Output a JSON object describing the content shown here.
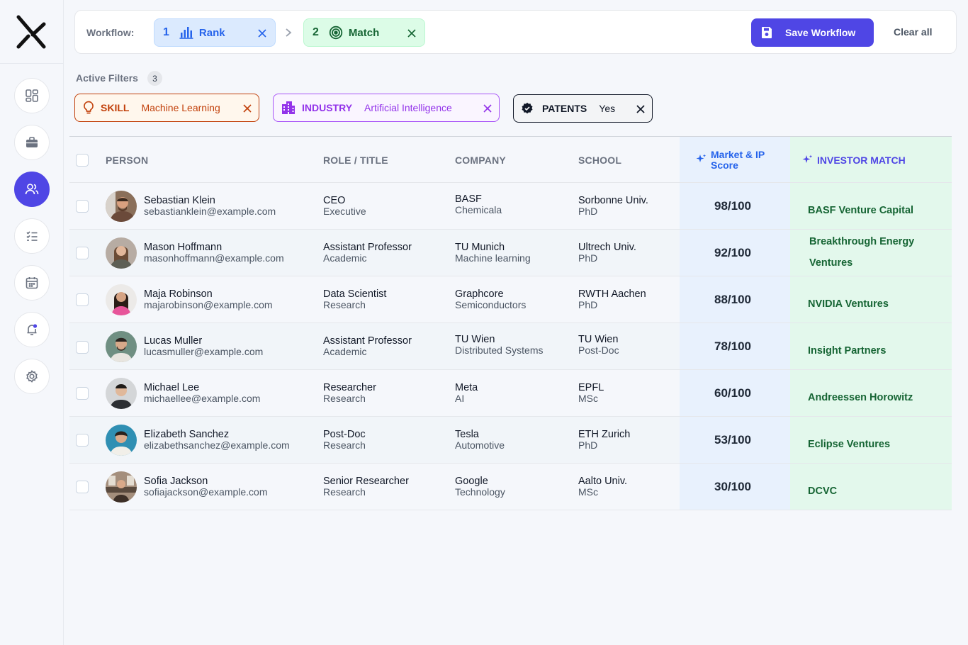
{
  "workflow": {
    "label": "Workflow:",
    "steps": [
      {
        "num": "1",
        "label": "Rank",
        "icon": "bar-chart-icon"
      },
      {
        "num": "2",
        "label": "Match",
        "icon": "target-icon"
      }
    ],
    "save_label": "Save Workflow",
    "clear_label": "Clear all"
  },
  "filters": {
    "label": "Active Filters",
    "count": "3",
    "chips": [
      {
        "key": "SKILL",
        "value": "Machine Learning",
        "icon": "lightbulb-icon"
      },
      {
        "key": "INDUSTRY",
        "value": "Artificial Intelligence",
        "icon": "building-icon"
      },
      {
        "key": "PATENTS",
        "value": "Yes",
        "icon": "badge-icon"
      }
    ]
  },
  "table": {
    "headers": {
      "person": "PERSON",
      "role": "ROLE / TITLE",
      "company": "COMPANY",
      "school": "SCHOOL",
      "score": "Market & IP Score",
      "investor": "INVESTOR MATCH"
    },
    "rows": [
      {
        "name": "Sebastian Klein",
        "email": "sebastianklein@example.com",
        "role": "CEO",
        "role_type": "Executive",
        "company": "BASF",
        "sector": "Chemicala",
        "school": "Sorbonne Univ.",
        "degree": "PhD",
        "score": "98/100",
        "investor": "BASF Venture Capital"
      },
      {
        "name": "Mason Hoffmann",
        "email": "masonhoffmann@example.com",
        "role": "Assistant Professor",
        "role_type": "Academic",
        "company": "TU Munich",
        "sector": "Machine learning",
        "school": "Ultrech Univ.",
        "degree": "PhD",
        "score": "92/100",
        "investor": "Breakthrough Energy Ventures"
      },
      {
        "name": "Maja Robinson",
        "email": "majarobinson@example.com",
        "role": "Data Scientist",
        "role_type": "Research",
        "company": "Graphcore",
        "sector": "Semiconductors",
        "school": "RWTH Aachen",
        "degree": "PhD",
        "score": "88/100",
        "investor": "NVIDIA Ventures"
      },
      {
        "name": "Lucas Muller",
        "email": "lucasmuller@example.com",
        "role": "Assistant Professor",
        "role_type": "Academic",
        "company": "TU Wien",
        "sector": "Distributed Systems",
        "school": "TU Wien",
        "degree": "Post-Doc",
        "score": "78/100",
        "investor": "Insight Partners"
      },
      {
        "name": "Michael Lee",
        "email": "michaellee@example.com",
        "role": "Researcher",
        "role_type": "Research",
        "company": "Meta",
        "sector": "AI",
        "school": "EPFL",
        "degree": "MSc",
        "score": "60/100",
        "investor": "Andreessen Horowitz"
      },
      {
        "name": "Elizabeth Sanchez",
        "email": "elizabethsanchez@example.com",
        "role": "Post-Doc",
        "role_type": "Research",
        "company": "Tesla",
        "sector": "Automotive",
        "school": "ETH Zurich",
        "degree": "PhD",
        "score": "53/100",
        "investor": "Eclipse Ventures"
      },
      {
        "name": "Sofia Jackson",
        "email": "sofiajackson@example.com",
        "role": "Senior Researcher",
        "role_type": "Research",
        "company": "Google",
        "sector": "Technology",
        "school": "Aalto Univ.",
        "degree": "MSc",
        "score": "30/100",
        "investor": "DCVC"
      }
    ]
  },
  "colors": {
    "accent": "#4f46e5",
    "rank": "#2563eb",
    "match": "#166534",
    "skill": "#c2410c",
    "industry": "#9333ea"
  }
}
